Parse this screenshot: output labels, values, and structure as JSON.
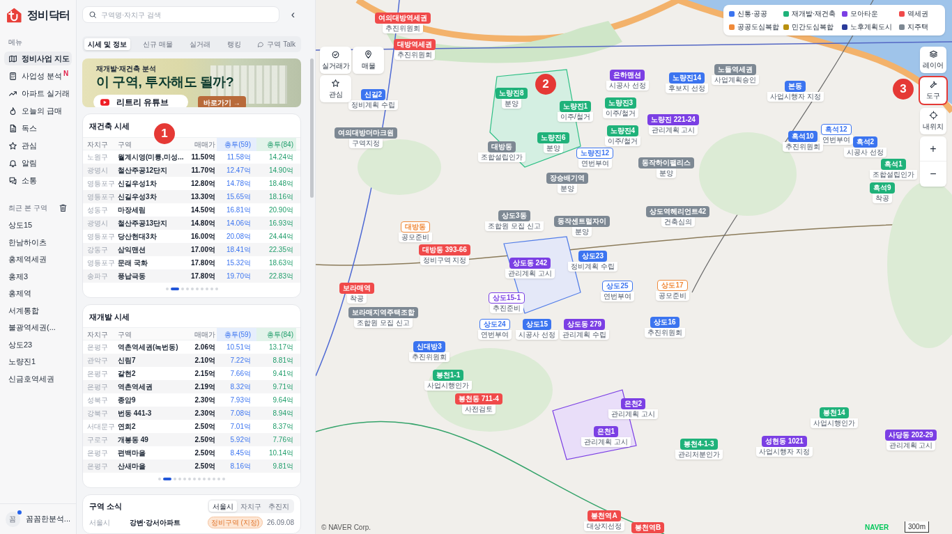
{
  "app": {
    "logo": "정비닥터"
  },
  "sidebar": {
    "menu_heading": "메뉴",
    "items": [
      {
        "label": "정비사업 지도",
        "selected": true
      },
      {
        "label": "사업성 분석",
        "selected": false,
        "badge": "N"
      },
      {
        "label": "아파트 실거래",
        "selected": false
      },
      {
        "label": "오늘의 급매",
        "selected": false
      },
      {
        "label": "독스",
        "selected": false
      },
      {
        "label": "관심",
        "selected": false
      },
      {
        "label": "알림",
        "selected": false
      },
      {
        "label": "소통",
        "selected": false
      }
    ],
    "recent_heading": "최근 본 구역",
    "recent": [
      "상도15",
      "한남하이츠",
      "홍제역세권",
      "홍제3",
      "홍제역",
      "서계통합",
      "불광역세권(...",
      "상도23",
      "노량진1",
      "신금호역세권"
    ],
    "user": {
      "avatar": "꼼",
      "name": "꼼꼼한분석...",
      "notification": true
    }
  },
  "panel": {
    "search": {
      "placeholder": "구역명·자치구 검색"
    },
    "collapse": "‹",
    "tabs": [
      {
        "label": "시세 및 정보",
        "selected": true
      },
      {
        "label": "신규 매물",
        "selected": false
      },
      {
        "label": "실거래",
        "selected": false
      },
      {
        "label": "랭킹",
        "selected": false
      },
      {
        "label": "구역 Talk",
        "selected": false
      }
    ],
    "banner": {
      "kicker": "재개발·재건축 분석",
      "headline": "이 구역, 투자해도 될까?",
      "channel": "리트리 유튜브",
      "cta": "바로가기 →"
    },
    "tables": [
      {
        "title": "재건축 시세",
        "columns": [
          "자치구",
          "구역",
          "매매가",
          "총투(59)",
          "총투(84)"
        ],
        "rows": [
          [
            "노원구",
            "월계시영(미륭,미성...",
            "11.50억",
            "11.58억",
            "14.24억"
          ],
          [
            "광명시",
            "철산주공12단지",
            "11.70억",
            "12.47억",
            "14.90억"
          ],
          [
            "영등포구",
            "신길우성1차",
            "12.80억",
            "14.78억",
            "18.48억"
          ],
          [
            "영등포구",
            "신길우성3차",
            "13.30억",
            "15.65억",
            "18.16억"
          ],
          [
            "성동구",
            "마장세림",
            "14.50억",
            "16.81억",
            "20.90억"
          ],
          [
            "광명시",
            "철산주공13단지",
            "14.80억",
            "14.06억",
            "16.93억"
          ],
          [
            "영등포구",
            "당산현대3차",
            "16.00억",
            "20.08억",
            "24.44억"
          ],
          [
            "강동구",
            "삼익맨션",
            "17.00억",
            "18.41억",
            "22.35억"
          ],
          [
            "영등포구",
            "문래 국화",
            "17.80억",
            "15.32억",
            "18.63억"
          ],
          [
            "송파구",
            "풍납극동",
            "17.80억",
            "19.70억",
            "22.83억"
          ]
        ],
        "pages": [
          {
            "selected": false
          },
          {
            "selected": true
          },
          {
            "selected": false
          },
          {
            "selected": false
          },
          {
            "selected": false
          },
          {
            "selected": false
          },
          {
            "selected": false
          },
          {
            "selected": false
          },
          {
            "selected": false
          },
          {
            "selected": false
          }
        ]
      },
      {
        "title": "재개발 시세",
        "columns": [
          "자치구",
          "구역",
          "매매가",
          "총투(59)",
          "총투(84)"
        ],
        "rows": [
          [
            "은평구",
            "역촌역세권(녹번동)",
            "2.06억",
            "10.51억",
            "13.17억"
          ],
          [
            "관악구",
            "신림7",
            "2.10억",
            "7.22억",
            "8.81억"
          ],
          [
            "은평구",
            "갈현2",
            "2.15억",
            "7.66억",
            "9.41억"
          ],
          [
            "은평구",
            "역촌역세권",
            "2.19억",
            "8.32억",
            "9.71억"
          ],
          [
            "성북구",
            "종암9",
            "2.30억",
            "7.93억",
            "9.64억"
          ],
          [
            "강북구",
            "번동 441-3",
            "2.30억",
            "7.08억",
            "8.94억"
          ],
          [
            "서대문구",
            "연희2",
            "2.50억",
            "7.01억",
            "8.37억"
          ],
          [
            "구로구",
            "개봉동 49",
            "2.50억",
            "5.92억",
            "7.76억"
          ],
          [
            "은평구",
            "편백마을",
            "2.50억",
            "8.45억",
            "10.14억"
          ],
          [
            "은평구",
            "산새마을",
            "2.50억",
            "8.16억",
            "9.81억"
          ]
        ],
        "pages": [
          {
            "selected": false
          },
          {
            "selected": true
          },
          {
            "selected": false
          },
          {
            "selected": false
          },
          {
            "selected": false
          },
          {
            "selected": false
          },
          {
            "selected": false
          },
          {
            "selected": false
          },
          {
            "selected": false
          },
          {
            "selected": false
          },
          {
            "selected": false
          },
          {
            "selected": false
          },
          {
            "selected": false
          }
        ]
      }
    ],
    "news": {
      "title": "구역 소식",
      "filters": [
        {
          "label": "서울시",
          "selected": true
        },
        {
          "label": "자치구",
          "selected": false
        },
        {
          "label": "추진지",
          "selected": false
        }
      ],
      "items": [
        {
          "region": "서울시",
          "name": "강변·강서아파트",
          "tag": "정비구역 (지정)",
          "date": "26.09.08"
        }
      ]
    }
  },
  "map": {
    "quick_buttons": [
      {
        "label": "실거래가"
      },
      {
        "label": "매물"
      },
      {
        "label": "관심"
      }
    ],
    "legend": [
      {
        "label": "신통·공공",
        "color": "#3b74f0"
      },
      {
        "label": "재개발·재건축",
        "color": "#1fb27a"
      },
      {
        "label": "모아타운",
        "color": "#7b3fe4"
      },
      {
        "label": "역세권",
        "color": "#f04a4a"
      },
      {
        "label": "공공도심복합",
        "color": "#f08a3a"
      },
      {
        "label": "민간도심복합",
        "color": "#b8900f"
      },
      {
        "label": "노후계획도시",
        "color": "#2a3a9a"
      },
      {
        "label": "지주택",
        "color": "#7d8893"
      }
    ],
    "tools": [
      {
        "label": "레이어",
        "highlighted": false
      },
      {
        "label": "도구",
        "highlighted": true
      },
      {
        "label": "내위치",
        "highlighted": false
      }
    ],
    "zoom": [
      "+",
      "−"
    ],
    "markers": [
      {
        "name": "여의대방역세권",
        "status": "추진위원회",
        "color": "#f04a4a",
        "kind": "filled"
      },
      {
        "name": "대방역세권",
        "status": "추진위원회",
        "color": "#f04a4a",
        "kind": "filled"
      },
      {
        "name": "은하맨션",
        "status": "시공사 선정",
        "color": "#7b3fe4",
        "kind": "filled"
      },
      {
        "name": "노량진14",
        "status": "후보지 선정",
        "color": "#3b74f0",
        "kind": "filled"
      },
      {
        "name": "노들역세권",
        "status": "사업계획승인",
        "color": "#7d8893",
        "kind": "filled"
      },
      {
        "name": "본동",
        "status": "사업시행자 지정",
        "color": "#3b74f0",
        "kind": "filled"
      },
      {
        "name": "신길2",
        "status": "정비계획 수립",
        "color": "#3b74f0",
        "kind": "filled"
      },
      {
        "name": "노량진8",
        "status": "분양",
        "color": "#1fb27a",
        "kind": "filled"
      },
      {
        "name": "노량진1",
        "status": "이주/철거",
        "color": "#1fb27a",
        "kind": "filled"
      },
      {
        "name": "노량진3",
        "status": "이주/철거",
        "color": "#1fb27a",
        "kind": "filled"
      },
      {
        "name": "노량진 221-24",
        "status": "관리계획 고시",
        "color": "#7b3fe4",
        "kind": "filled"
      },
      {
        "name": "여의대방더마크원",
        "status": "구역지정",
        "color": "#7d8893",
        "kind": "filled"
      },
      {
        "name": "노량진4",
        "status": "이주/철거",
        "color": "#1fb27a",
        "kind": "filled"
      },
      {
        "name": "흑석12",
        "status": "연번부여",
        "color": "#3b74f0",
        "kind": "outline"
      },
      {
        "name": "대방동",
        "status": "조합설립인가",
        "color": "#7d8893",
        "kind": "filled"
      },
      {
        "name": "노량진6",
        "status": "분양",
        "color": "#1fb27a",
        "kind": "filled"
      },
      {
        "name": "노량진12",
        "status": "연번부여",
        "color": "#3b74f0",
        "kind": "outline"
      },
      {
        "name": "흑석10",
        "status": "추진위원회",
        "color": "#3b74f0",
        "kind": "filled"
      },
      {
        "name": "흑석2",
        "status": "시공사 선정",
        "color": "#3b74f0",
        "kind": "filled"
      },
      {
        "name": "동작하이팰리스",
        "status": "분양",
        "color": "#7d8893",
        "kind": "filled"
      },
      {
        "name": "흑석1",
        "status": "조합설립인가",
        "color": "#1fb27a",
        "kind": "filled"
      },
      {
        "name": "장승배기역",
        "status": "분양",
        "color": "#7d8893",
        "kind": "filled"
      },
      {
        "name": "흑석9",
        "status": "착공",
        "color": "#1fb27a",
        "kind": "filled"
      },
      {
        "name": "상도3동",
        "status": "조합원 모집 신고",
        "color": "#7d8893",
        "kind": "filled"
      },
      {
        "name": "동작센트럴자이",
        "status": "분양",
        "color": "#7d8893",
        "kind": "filled"
      },
      {
        "name": "상도역헤리언트42",
        "status": "건축심의",
        "color": "#7d8893",
        "kind": "filled"
      },
      {
        "name": "대방동",
        "status": "공모준비",
        "color": "#f08a3a",
        "kind": "outline"
      },
      {
        "name": "대방동 393-66",
        "status": "정비구역 지정",
        "color": "#f04a4a",
        "kind": "filled"
      },
      {
        "name": "상도동 242",
        "status": "관리계획 고시",
        "color": "#7b3fe4",
        "kind": "filled"
      },
      {
        "name": "상도23",
        "status": "정비계획 수립",
        "color": "#3b74f0",
        "kind": "filled"
      },
      {
        "name": "보라매역",
        "status": "착공",
        "color": "#f04a4a",
        "kind": "filled"
      },
      {
        "name": "상도25",
        "status": "연번부여",
        "color": "#3b74f0",
        "kind": "outline"
      },
      {
        "name": "상도17",
        "status": "공모준비",
        "color": "#f08a3a",
        "kind": "outline"
      },
      {
        "name": "상도15-1",
        "status": "추진준비",
        "color": "#7b3fe4",
        "kind": "outline"
      },
      {
        "name": "보라매지역주택조합",
        "status": "조합원 모집 신고",
        "color": "#7d8893",
        "kind": "filled"
      },
      {
        "name": "상도24",
        "status": "연번부여",
        "color": "#3b74f0",
        "kind": "outline"
      },
      {
        "name": "상도15",
        "status": "시공사 선정",
        "color": "#3b74f0",
        "kind": "filled"
      },
      {
        "name": "상도동 279",
        "status": "관리계획 수립",
        "color": "#7b3fe4",
        "kind": "filled"
      },
      {
        "name": "상도16",
        "status": "추진위원회",
        "color": "#3b74f0",
        "kind": "filled"
      },
      {
        "name": "신대방3",
        "status": "추진위원회",
        "color": "#3b74f0",
        "kind": "filled"
      },
      {
        "name": "봉천1-1",
        "status": "사업시행인가",
        "color": "#1fb27a",
        "kind": "filled"
      },
      {
        "name": "봉천동 711-4",
        "status": "사전검토",
        "color": "#f04a4a",
        "kind": "filled"
      },
      {
        "name": "은천2",
        "status": "관리계획 고시",
        "color": "#7b3fe4",
        "kind": "filled"
      },
      {
        "name": "봉천14",
        "status": "사업시행인가",
        "color": "#1fb27a",
        "kind": "filled"
      },
      {
        "name": "은천1",
        "status": "관리계획 고시",
        "color": "#7b3fe4",
        "kind": "filled"
      },
      {
        "name": "봉천4-1-3",
        "status": "관리처분인가",
        "color": "#1fb27a",
        "kind": "filled"
      },
      {
        "name": "성현동 1021",
        "status": "사업시행자 지정",
        "color": "#7b3fe4",
        "kind": "filled"
      },
      {
        "name": "사당동 202-29",
        "status": "관리계획 고시",
        "color": "#7b3fe4",
        "kind": "filled"
      },
      {
        "name": "봉천역A",
        "status": "대상지선정",
        "color": "#f04a4a",
        "kind": "filled"
      },
      {
        "name": "봉천역B",
        "color": "#f04a4a",
        "kind": "filled"
      }
    ],
    "callouts": [
      "1",
      "2",
      "3"
    ],
    "attribution": "© NAVER Corp.",
    "logo": "NAVER",
    "scale": "300m"
  }
}
